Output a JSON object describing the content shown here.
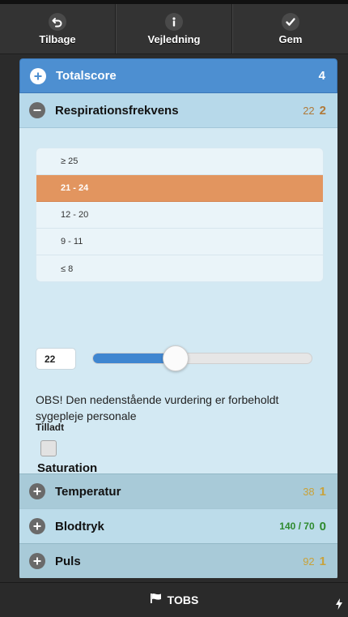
{
  "toolbar": {
    "back_label": "Tilbage",
    "guide_label": "Vejledning",
    "save_label": "Gem"
  },
  "sections": {
    "total": {
      "title": "Totalscore",
      "score": "4"
    },
    "respiration": {
      "title": "Respirationsfrekvens",
      "value": "22",
      "score": "2",
      "choices": [
        "≥ 25",
        "21 - 24",
        "12 - 20",
        "9 - 11",
        "≤ 8"
      ],
      "selected_choice": "21 - 24",
      "slider_value": "22",
      "slider_fill_fraction": 0.38
    },
    "note": "OBS! Den nedenstående vurdering er forbeholdt sygepleje personale",
    "permission_label": "Tilladt",
    "saturation": {
      "title": "Saturation",
      "value": "",
      "slider_fill_fraction": 0.0
    },
    "temperature": {
      "title": "Temperatur",
      "value": "38",
      "score": "1"
    },
    "blood_pressure": {
      "title": "Blodtryk",
      "value": "140 / 70",
      "score": "0"
    },
    "pulse": {
      "title": "Puls",
      "value": "92",
      "score": "1"
    }
  },
  "footer": {
    "label": "TOBS"
  },
  "colors": {
    "accent_blue": "#4d8fd1",
    "selected_orange": "#e2955f",
    "score_orange": "#b07a3a",
    "score_yellow": "#c9a23a",
    "score_green": "#2e8a2e"
  }
}
